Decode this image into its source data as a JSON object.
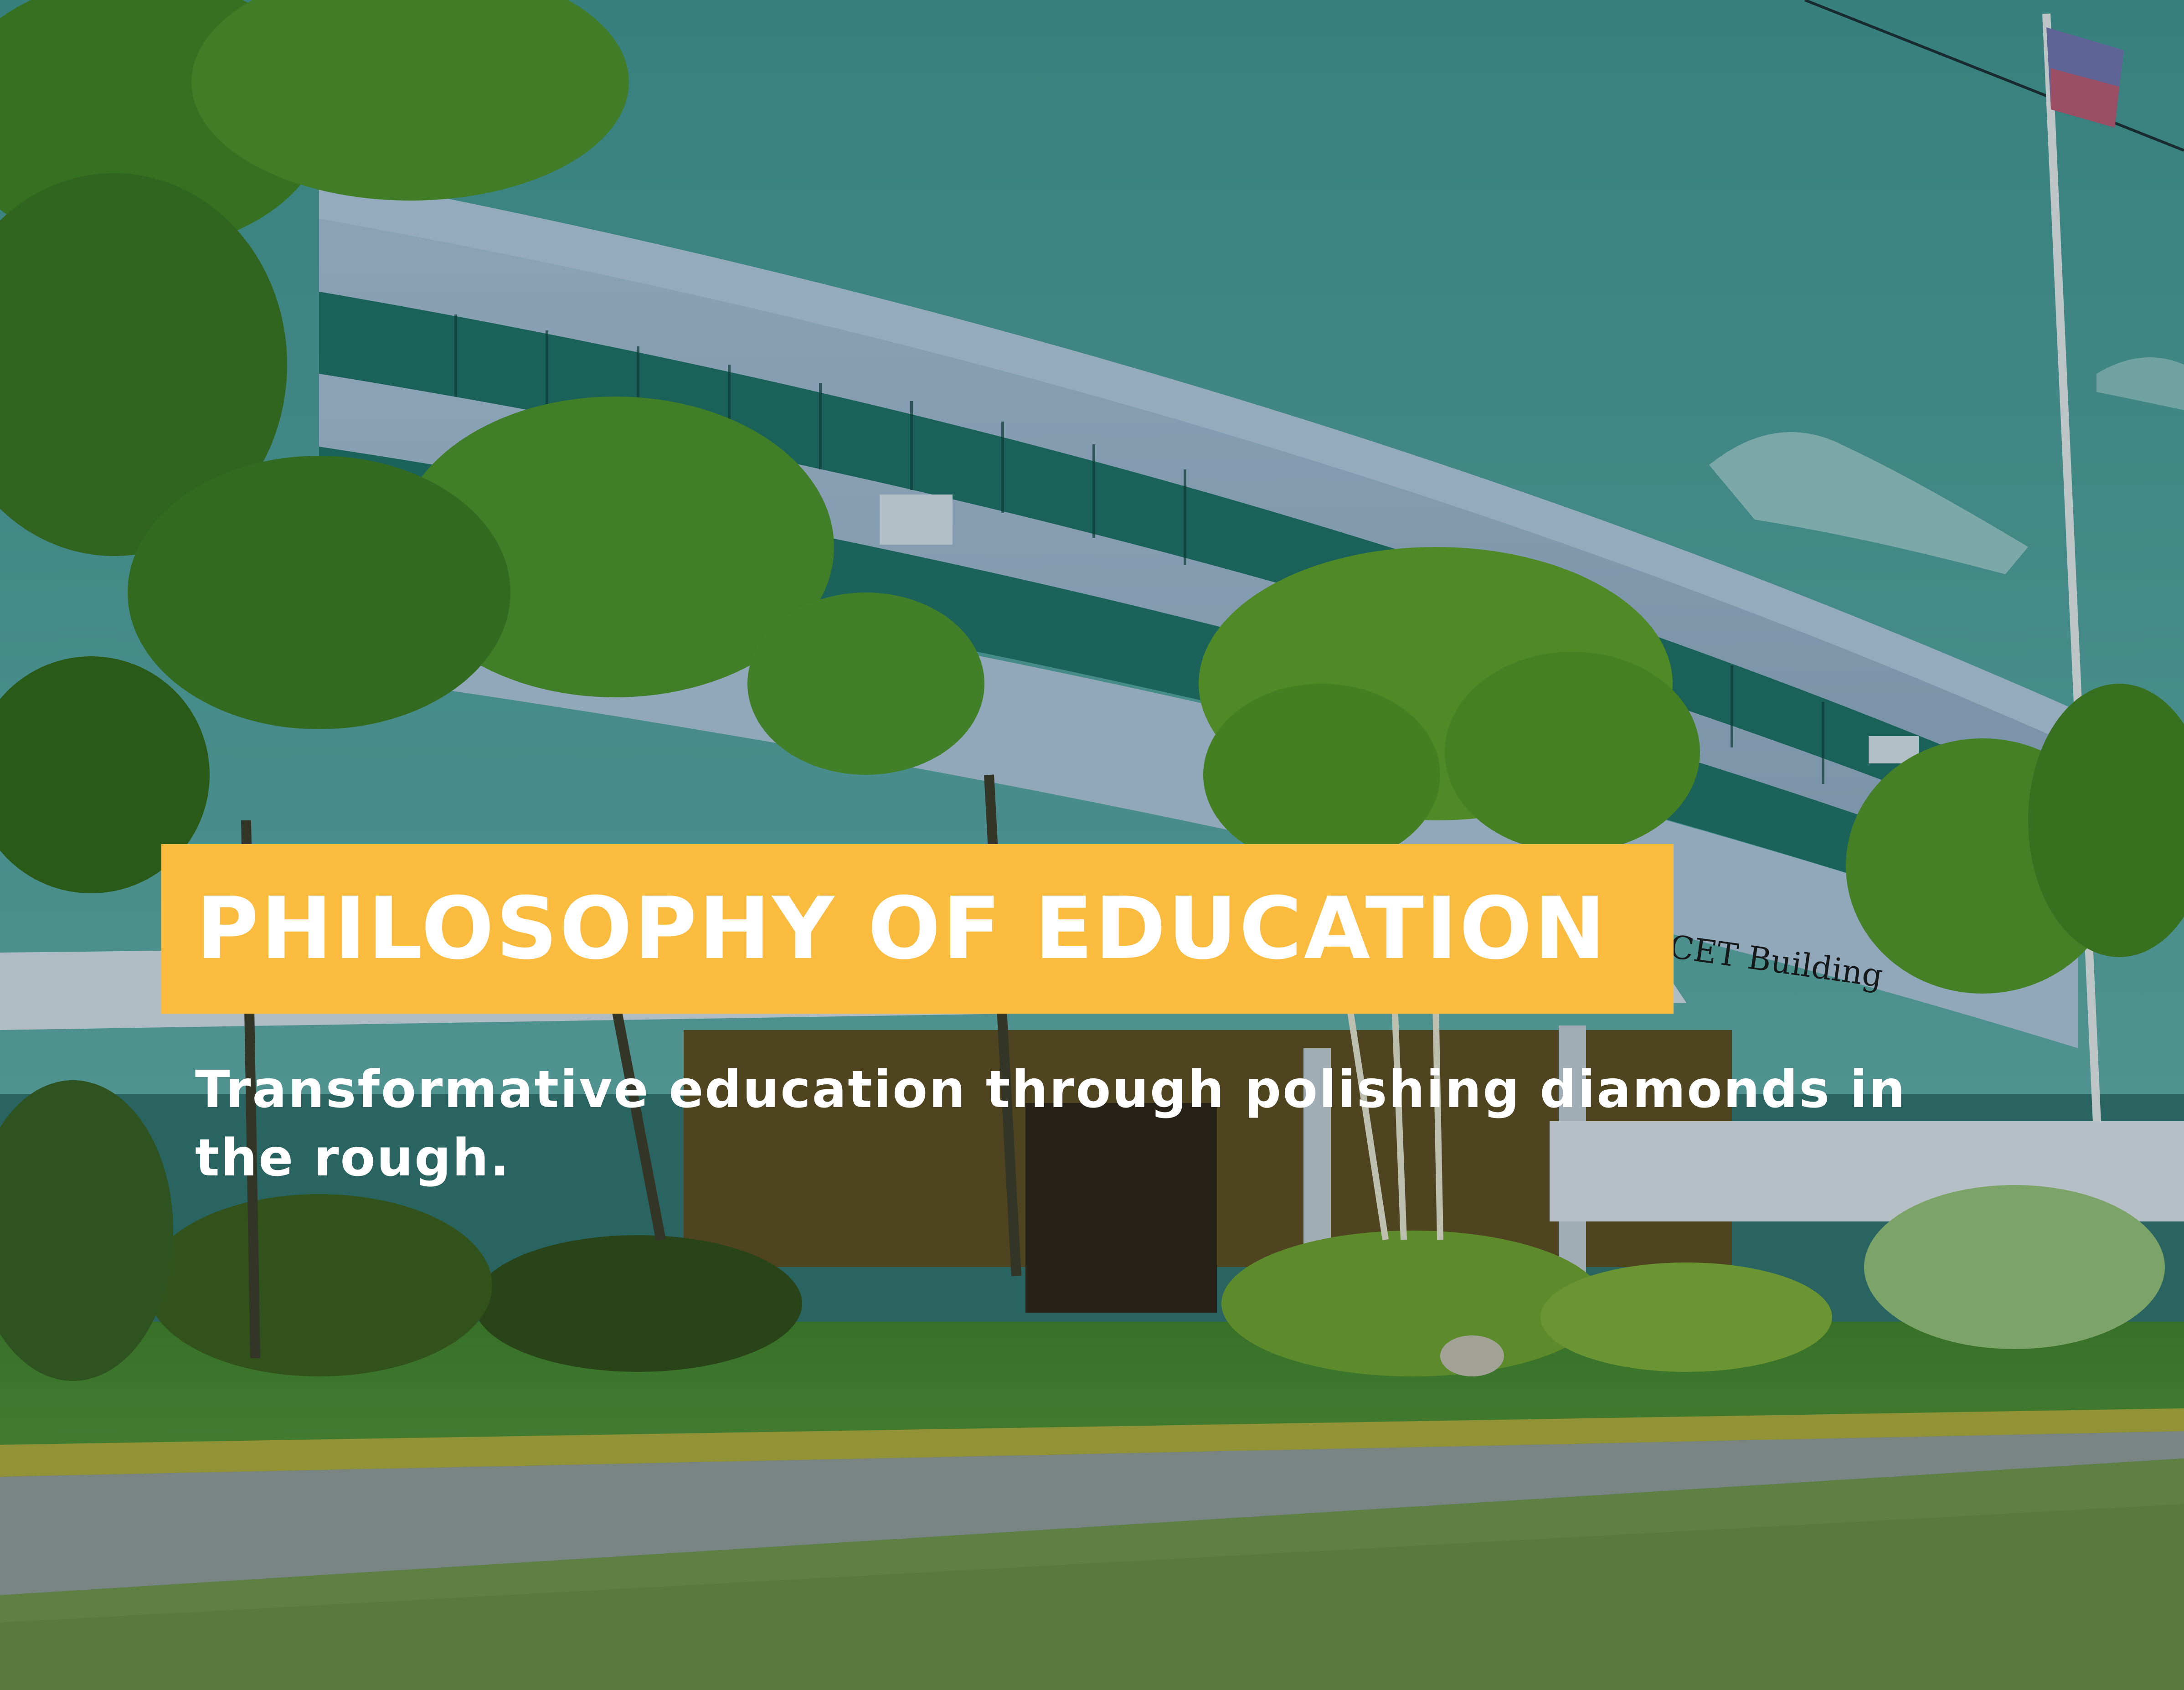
{
  "slide": {
    "title": "PHILOSOPHY OF EDUCATION",
    "subtitle": "Transformative education through polishing diamonds in the rough.",
    "accent_color": "#fbbb3f"
  },
  "photo": {
    "building_sign": "CET Building"
  }
}
